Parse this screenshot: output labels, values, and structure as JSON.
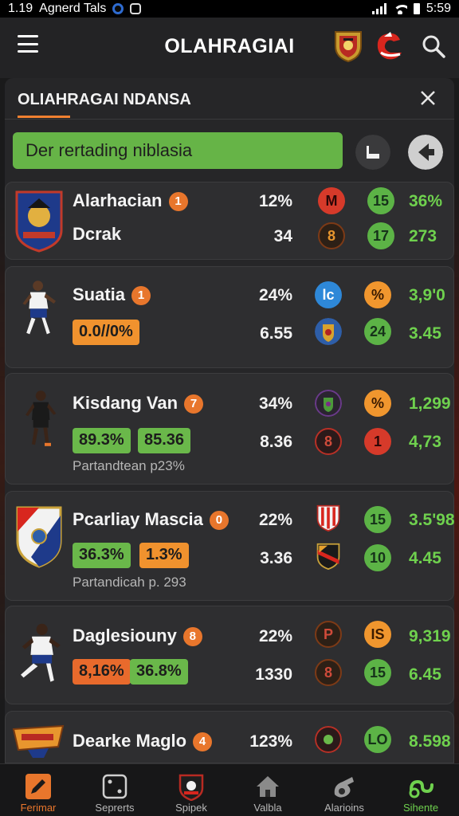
{
  "status_bar": {
    "time_left": "1.19",
    "carrier": "Agnerd Tals",
    "time_right": "5:59"
  },
  "app_bar": {
    "title": "OLAHRAGIAI"
  },
  "panel": {
    "title": "OLIAHRAGAI NDANSA"
  },
  "banner": {
    "text": "Der rertading niblasia"
  },
  "cards": [
    {
      "name": "Alarhacian",
      "badge": "1",
      "sub": "Dcrak",
      "row1": {
        "value": "12%",
        "icon": "M",
        "circle": "15",
        "score": "36%"
      },
      "row2": {
        "value": "34",
        "icon": "8",
        "circle": "17",
        "score": "273"
      }
    },
    {
      "name": "Suatia",
      "badge": "1",
      "pills": [
        "0.0//0%"
      ],
      "row1": {
        "value": "24%",
        "icon": "lc",
        "circle": "%",
        "score": "3,9'0"
      },
      "row2": {
        "value": "6.55",
        "icon": "",
        "circle": "24",
        "score": "3.45"
      }
    },
    {
      "name": "Kisdang Van",
      "badge": "7",
      "pills": [
        "89.3%",
        "85.36"
      ],
      "note": "Partandtean p23%",
      "row1": {
        "value": "34%",
        "icon": "",
        "circle": "%",
        "score": "1,299"
      },
      "row2": {
        "value": "8.36",
        "icon": "8",
        "circle": "1",
        "score": "4,73"
      }
    },
    {
      "name": "Pcarliay Mascia",
      "badge": "0",
      "pills": [
        "36.3%",
        "1.3%"
      ],
      "note": "Partandicah p. 293",
      "row1": {
        "value": "22%",
        "icon": "",
        "circle": "15",
        "score": "3.5'98"
      },
      "row2": {
        "value": "3.36",
        "icon": "",
        "circle": "10",
        "score": "4.45"
      }
    },
    {
      "name": "Daglesiouny",
      "badge": "8",
      "pills": [
        "8,16%",
        "36.8%"
      ],
      "row1": {
        "value": "22%",
        "icon": "P",
        "circle": "IS",
        "score": "9,319"
      },
      "row2": {
        "value": "1330",
        "icon": "8",
        "circle": "15",
        "score": "6.45"
      }
    },
    {
      "name": "Dearke Maglo",
      "badge": "4",
      "row1": {
        "value": "123%",
        "icon": "",
        "circle": "LO",
        "score": "8.598"
      }
    }
  ],
  "tabs": [
    "Ferimar",
    "Seprerts",
    "Spipek",
    "Valbla",
    "Alarioins",
    "Sihente"
  ],
  "colors": {
    "accent": "#e8762c",
    "positive": "#6fd14e",
    "banner": "#66b447"
  }
}
